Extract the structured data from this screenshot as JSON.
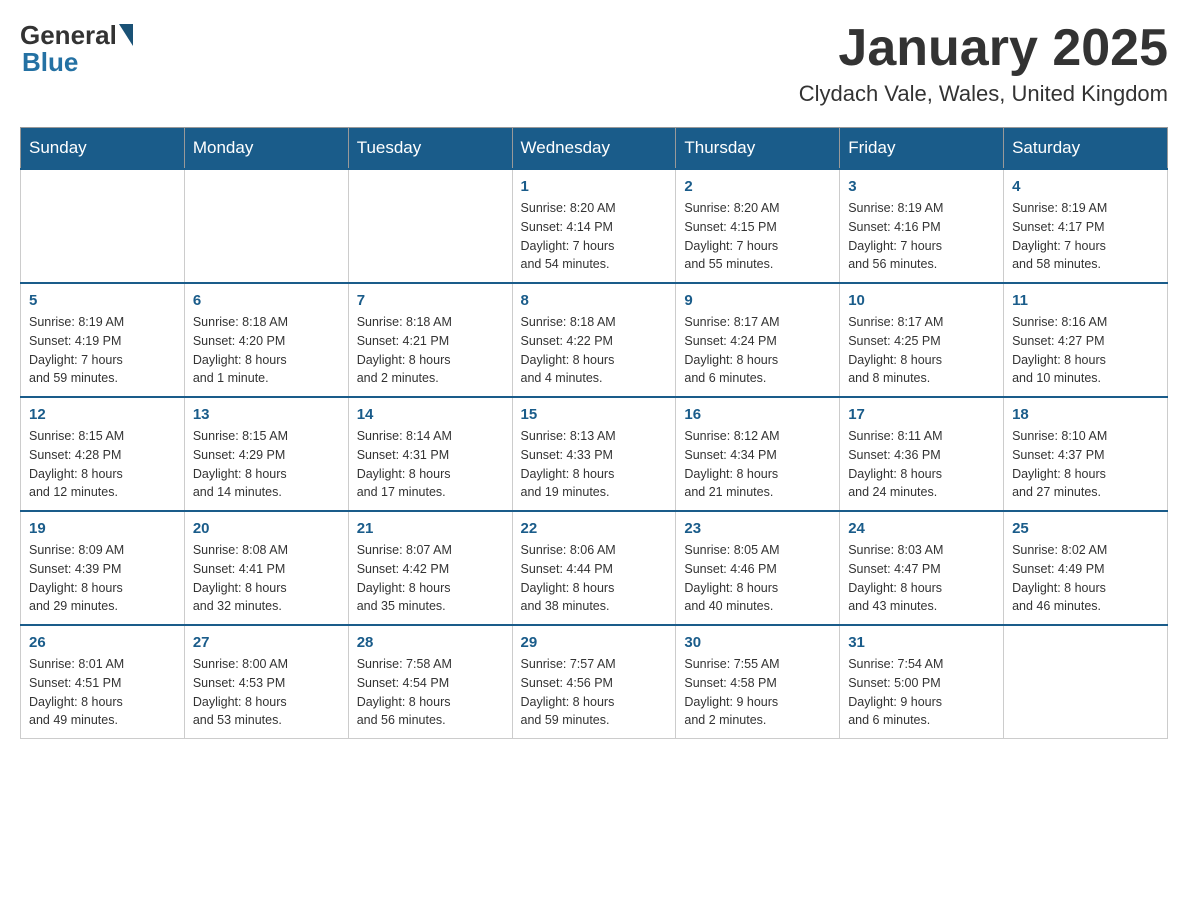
{
  "header": {
    "logo": {
      "text_general": "General",
      "text_blue": "Blue"
    },
    "month_title": "January 2025",
    "location": "Clydach Vale, Wales, United Kingdom"
  },
  "weekdays": [
    "Sunday",
    "Monday",
    "Tuesday",
    "Wednesday",
    "Thursday",
    "Friday",
    "Saturday"
  ],
  "weeks": [
    [
      {
        "day": "",
        "info": ""
      },
      {
        "day": "",
        "info": ""
      },
      {
        "day": "",
        "info": ""
      },
      {
        "day": "1",
        "info": "Sunrise: 8:20 AM\nSunset: 4:14 PM\nDaylight: 7 hours\nand 54 minutes."
      },
      {
        "day": "2",
        "info": "Sunrise: 8:20 AM\nSunset: 4:15 PM\nDaylight: 7 hours\nand 55 minutes."
      },
      {
        "day": "3",
        "info": "Sunrise: 8:19 AM\nSunset: 4:16 PM\nDaylight: 7 hours\nand 56 minutes."
      },
      {
        "day": "4",
        "info": "Sunrise: 8:19 AM\nSunset: 4:17 PM\nDaylight: 7 hours\nand 58 minutes."
      }
    ],
    [
      {
        "day": "5",
        "info": "Sunrise: 8:19 AM\nSunset: 4:19 PM\nDaylight: 7 hours\nand 59 minutes."
      },
      {
        "day": "6",
        "info": "Sunrise: 8:18 AM\nSunset: 4:20 PM\nDaylight: 8 hours\nand 1 minute."
      },
      {
        "day": "7",
        "info": "Sunrise: 8:18 AM\nSunset: 4:21 PM\nDaylight: 8 hours\nand 2 minutes."
      },
      {
        "day": "8",
        "info": "Sunrise: 8:18 AM\nSunset: 4:22 PM\nDaylight: 8 hours\nand 4 minutes."
      },
      {
        "day": "9",
        "info": "Sunrise: 8:17 AM\nSunset: 4:24 PM\nDaylight: 8 hours\nand 6 minutes."
      },
      {
        "day": "10",
        "info": "Sunrise: 8:17 AM\nSunset: 4:25 PM\nDaylight: 8 hours\nand 8 minutes."
      },
      {
        "day": "11",
        "info": "Sunrise: 8:16 AM\nSunset: 4:27 PM\nDaylight: 8 hours\nand 10 minutes."
      }
    ],
    [
      {
        "day": "12",
        "info": "Sunrise: 8:15 AM\nSunset: 4:28 PM\nDaylight: 8 hours\nand 12 minutes."
      },
      {
        "day": "13",
        "info": "Sunrise: 8:15 AM\nSunset: 4:29 PM\nDaylight: 8 hours\nand 14 minutes."
      },
      {
        "day": "14",
        "info": "Sunrise: 8:14 AM\nSunset: 4:31 PM\nDaylight: 8 hours\nand 17 minutes."
      },
      {
        "day": "15",
        "info": "Sunrise: 8:13 AM\nSunset: 4:33 PM\nDaylight: 8 hours\nand 19 minutes."
      },
      {
        "day": "16",
        "info": "Sunrise: 8:12 AM\nSunset: 4:34 PM\nDaylight: 8 hours\nand 21 minutes."
      },
      {
        "day": "17",
        "info": "Sunrise: 8:11 AM\nSunset: 4:36 PM\nDaylight: 8 hours\nand 24 minutes."
      },
      {
        "day": "18",
        "info": "Sunrise: 8:10 AM\nSunset: 4:37 PM\nDaylight: 8 hours\nand 27 minutes."
      }
    ],
    [
      {
        "day": "19",
        "info": "Sunrise: 8:09 AM\nSunset: 4:39 PM\nDaylight: 8 hours\nand 29 minutes."
      },
      {
        "day": "20",
        "info": "Sunrise: 8:08 AM\nSunset: 4:41 PM\nDaylight: 8 hours\nand 32 minutes."
      },
      {
        "day": "21",
        "info": "Sunrise: 8:07 AM\nSunset: 4:42 PM\nDaylight: 8 hours\nand 35 minutes."
      },
      {
        "day": "22",
        "info": "Sunrise: 8:06 AM\nSunset: 4:44 PM\nDaylight: 8 hours\nand 38 minutes."
      },
      {
        "day": "23",
        "info": "Sunrise: 8:05 AM\nSunset: 4:46 PM\nDaylight: 8 hours\nand 40 minutes."
      },
      {
        "day": "24",
        "info": "Sunrise: 8:03 AM\nSunset: 4:47 PM\nDaylight: 8 hours\nand 43 minutes."
      },
      {
        "day": "25",
        "info": "Sunrise: 8:02 AM\nSunset: 4:49 PM\nDaylight: 8 hours\nand 46 minutes."
      }
    ],
    [
      {
        "day": "26",
        "info": "Sunrise: 8:01 AM\nSunset: 4:51 PM\nDaylight: 8 hours\nand 49 minutes."
      },
      {
        "day": "27",
        "info": "Sunrise: 8:00 AM\nSunset: 4:53 PM\nDaylight: 8 hours\nand 53 minutes."
      },
      {
        "day": "28",
        "info": "Sunrise: 7:58 AM\nSunset: 4:54 PM\nDaylight: 8 hours\nand 56 minutes."
      },
      {
        "day": "29",
        "info": "Sunrise: 7:57 AM\nSunset: 4:56 PM\nDaylight: 8 hours\nand 59 minutes."
      },
      {
        "day": "30",
        "info": "Sunrise: 7:55 AM\nSunset: 4:58 PM\nDaylight: 9 hours\nand 2 minutes."
      },
      {
        "day": "31",
        "info": "Sunrise: 7:54 AM\nSunset: 5:00 PM\nDaylight: 9 hours\nand 6 minutes."
      },
      {
        "day": "",
        "info": ""
      }
    ]
  ]
}
